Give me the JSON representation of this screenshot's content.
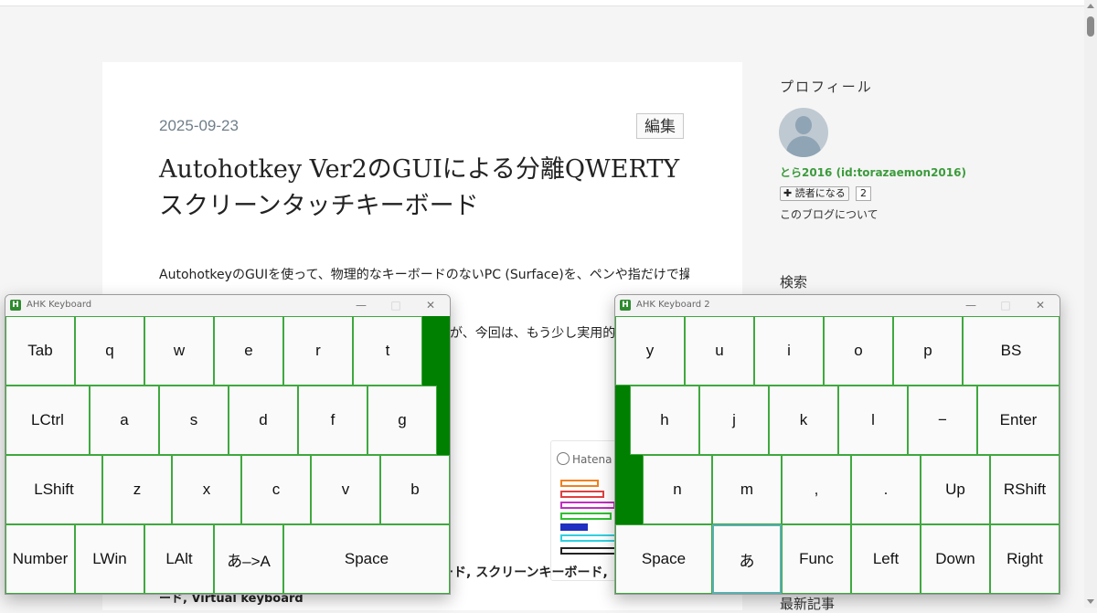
{
  "article": {
    "date": "2025-09-23",
    "edit_label": "編集",
    "title": "Autohotkey Ver2のGUIによる分離QWERTYスクリーンタッチキーボード",
    "paragraph1": "AutohotkeyのGUIを使って、物理的なキーボードのないPC (Surface)を、ペンや指だけで操",
    "paragraph2_visible": "が、今回は、もう少し実用的な",
    "keywords_visible": "ード, スクリーンキーボード,",
    "keywords_line2": "ード, Virtual keyboard",
    "card": {
      "label": "Hatena Blog"
    }
  },
  "sidebar": {
    "profile_title": "プロフィール",
    "user_link": "とら2016 (id:torazaemon2016)",
    "reader_button": "✚ 読者になる",
    "reader_count": "2",
    "about_link": "このブログについて",
    "search_title": "検索",
    "recent_title": "最新記事"
  },
  "window_left": {
    "title": "AHK Keyboard",
    "icon_letter": "H",
    "minimize": "—",
    "maximize": "□",
    "close": "✕",
    "rows": [
      [
        "Tab",
        "q",
        "w",
        "e",
        "r",
        "t",
        ""
      ],
      [
        "LCtrl",
        "a",
        "s",
        "d",
        "f",
        "g",
        ""
      ],
      [
        "LShift",
        "z",
        "x",
        "c",
        "v",
        "b"
      ],
      [
        "Number",
        "LWin",
        "LAlt",
        "あ–>A",
        "Space"
      ]
    ]
  },
  "window_right": {
    "title": "AHK Keyboard 2",
    "icon_letter": "H",
    "minimize": "—",
    "maximize": "□",
    "close": "✕",
    "rows": [
      [
        "y",
        "u",
        "i",
        "o",
        "p",
        "BS"
      ],
      [
        "",
        "h",
        "j",
        "k",
        "l",
        "−",
        "Enter"
      ],
      [
        "",
        "n",
        "m",
        ",",
        ".",
        "Up",
        "RShift"
      ],
      [
        "Space",
        "あ",
        "Func",
        "Left",
        "Down",
        "Right"
      ]
    ]
  },
  "colors": {
    "key_border": "#3fa83f",
    "gap_fill": "#008000",
    "link_green": "#3c9b3c"
  }
}
